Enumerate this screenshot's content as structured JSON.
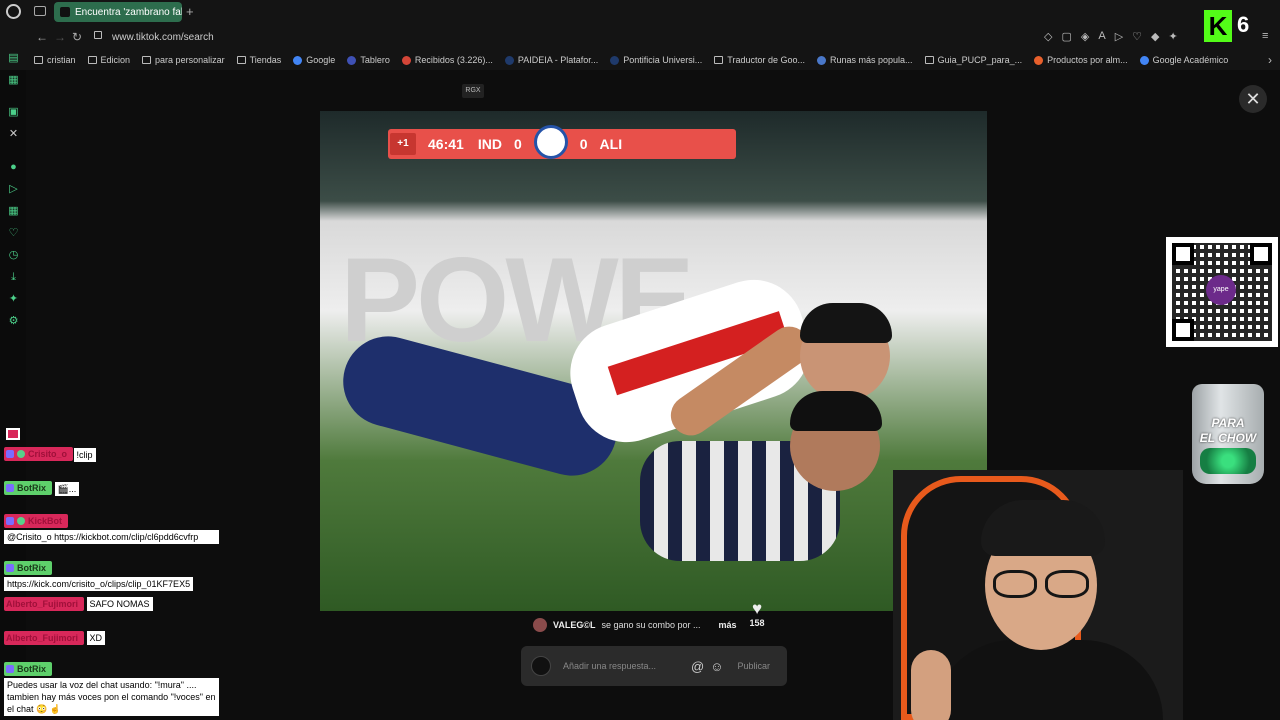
{
  "browser": {
    "tab_title": "Encuentra 'zambrano falta",
    "new_tab": "+",
    "url": "www.tiktok.com/search",
    "nav": {
      "back": "←",
      "forward": "→",
      "reload": "↻"
    }
  },
  "bookmarks": [
    {
      "label": "cristian",
      "icon": "folder-icon"
    },
    {
      "label": "Edicion",
      "icon": "folder-icon"
    },
    {
      "label": "para personalizar",
      "icon": "folder-icon"
    },
    {
      "label": "Tiendas",
      "icon": "folder-icon"
    },
    {
      "label": "Google",
      "icon": "google-icon",
      "color": "#4285f4"
    },
    {
      "label": "Tablero",
      "icon": "tablero-icon",
      "color": "#3f51b5"
    },
    {
      "label": "Recibidos (3.226)...",
      "icon": "gmail-icon",
      "color": "#d44638"
    },
    {
      "label": "PAIDEIA - Platafor...",
      "icon": "paideia-icon",
      "color": "#1f3a6b"
    },
    {
      "label": "Pontificia Universi...",
      "icon": "pucp-icon",
      "color": "#1f3a6b"
    },
    {
      "label": "Traductor de Goo...",
      "icon": "folder-icon"
    },
    {
      "label": "Runas más popula...",
      "icon": "runas-icon",
      "color": "#4a78c9"
    },
    {
      "label": "Guia_PUCP_para_...",
      "icon": "doc-icon"
    },
    {
      "label": "Productos por alm...",
      "icon": "productos-icon",
      "color": "#e8602c"
    },
    {
      "label": "Google Académico",
      "icon": "scholar-icon",
      "color": "#4285f4"
    }
  ],
  "overlay": {
    "rgx": "RGX",
    "close": "✕",
    "score": {
      "plus": "+1",
      "time": "46:41",
      "home": "IND",
      "home_score": "0",
      "away_score": "0",
      "away": "ALI"
    },
    "ad_text": "POWE"
  },
  "comment": {
    "user": "VALEG©L",
    "text": "se gano su combo por ...",
    "more": "más",
    "likes": "158"
  },
  "reply": {
    "placeholder": "Añadir una respuesta...",
    "mention": "@",
    "emoji": "☺",
    "publish": "Publicar"
  },
  "stream": {
    "jar_label_1": "PARA",
    "jar_label_2": "EL CHOW",
    "qr_brand": "yape",
    "kick_counter": "6"
  },
  "chat": [
    {
      "user": "Crisito_o",
      "style": "red",
      "text": "!clip"
    },
    {
      "user": "BotRix",
      "style": "green",
      "text": "🎬..."
    },
    {
      "user": "KickBot",
      "style": "red",
      "text": "@Crisito_o https://kickbot.com/clip/cl6pdd6cvfrp"
    },
    {
      "user": "BotRix",
      "style": "green",
      "text": "https://kick.com/crisito_o/clips/clip_01KF7EX5"
    },
    {
      "user": "Alberto_Fujimori",
      "style": "red",
      "text": "SAFO NOMAS"
    },
    {
      "user": "Alberto_Fujimori",
      "style": "red",
      "text": "XD"
    },
    {
      "user": "BotRix",
      "style": "green",
      "text": "Puedes usar la voz del chat usando: \"!mura\" .... tambien hay más voces pon el comando \"!voces\" en el chat 😳 ☝️"
    }
  ]
}
